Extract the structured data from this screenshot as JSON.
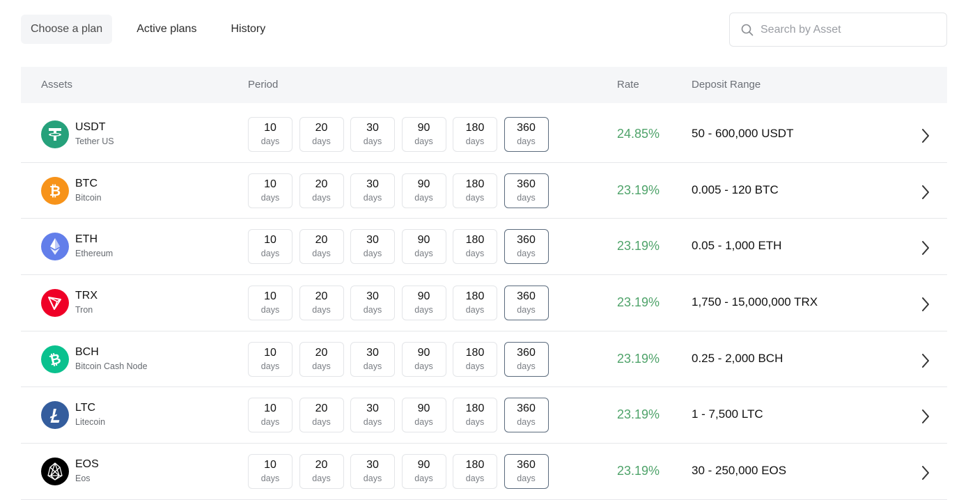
{
  "tabs": [
    {
      "label": "Choose a plan",
      "active": true
    },
    {
      "label": "Active plans",
      "active": false
    },
    {
      "label": "History",
      "active": false
    }
  ],
  "search": {
    "placeholder": "Search by Asset"
  },
  "table": {
    "headers": {
      "assets": "Assets",
      "period": "Period",
      "rate": "Rate",
      "deposit": "Deposit Range"
    },
    "period_unit": "days",
    "periods": [
      "10",
      "20",
      "30",
      "90",
      "180",
      "360"
    ],
    "selected_period": "360",
    "rows": [
      {
        "symbol": "USDT",
        "name": "Tether US",
        "rate": "24.85%",
        "range": "50 - 600,000 USDT",
        "icon": "tether-icon",
        "color": "#26a17b"
      },
      {
        "symbol": "BTC",
        "name": "Bitcoin",
        "rate": "23.19%",
        "range": "0.005 - 120 BTC",
        "icon": "bitcoin-icon",
        "color": "#f7931a"
      },
      {
        "symbol": "ETH",
        "name": "Ethereum",
        "rate": "23.19%",
        "range": "0.05 - 1,000 ETH",
        "icon": "ethereum-icon",
        "color": "#627eea"
      },
      {
        "symbol": "TRX",
        "name": "Tron",
        "rate": "23.19%",
        "range": "1,750 - 15,000,000 TRX",
        "icon": "tron-icon",
        "color": "#ef0027"
      },
      {
        "symbol": "BCH",
        "name": "Bitcoin Cash Node",
        "rate": "23.19%",
        "range": "0.25 - 2,000 BCH",
        "icon": "bitcoin-cash-icon",
        "color": "#0ac18e"
      },
      {
        "symbol": "LTC",
        "name": "Litecoin",
        "rate": "23.19%",
        "range": "1 - 7,500 LTC",
        "icon": "litecoin-icon",
        "color": "#345d9d"
      },
      {
        "symbol": "EOS",
        "name": "Eos",
        "rate": "23.19%",
        "range": "30 - 250,000 EOS",
        "icon": "eos-icon",
        "color": "#000000"
      }
    ]
  },
  "colors": {
    "rate": "#4fa36a",
    "selected_border": "#5b6b7d",
    "header_bg": "#f5f6f8"
  }
}
